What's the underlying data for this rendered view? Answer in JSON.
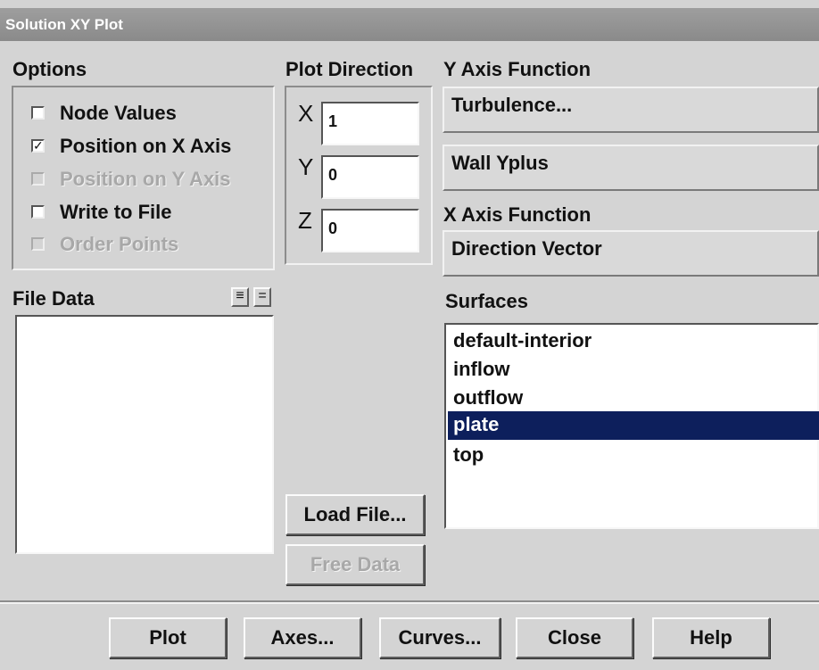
{
  "window": {
    "title": "Solution XY Plot"
  },
  "options": {
    "heading": "Options",
    "items": [
      {
        "label": "Node Values",
        "checked": false,
        "enabled": true
      },
      {
        "label": "Position on X Axis",
        "checked": true,
        "enabled": true
      },
      {
        "label": "Position on Y Axis",
        "checked": false,
        "enabled": false
      },
      {
        "label": "Write to File",
        "checked": false,
        "enabled": true
      },
      {
        "label": "Order Points",
        "checked": false,
        "enabled": false
      }
    ]
  },
  "plot_direction": {
    "heading": "Plot Direction",
    "x_label": "X",
    "x_value": "1",
    "y_label": "Y",
    "y_value": "0",
    "z_label": "Z",
    "z_value": "0"
  },
  "y_axis_function": {
    "heading": "Y Axis Function",
    "category": "Turbulence...",
    "quantity": "Wall Yplus"
  },
  "x_axis_function": {
    "heading": "X Axis Function",
    "value": "Direction Vector"
  },
  "file_data": {
    "heading": "File Data",
    "icon_select_all": "≡",
    "icon_deselect_all": "="
  },
  "surfaces": {
    "heading": "Surfaces",
    "items": [
      "default-interior",
      "inflow",
      "outflow",
      "plate",
      "top"
    ],
    "selected": "plate"
  },
  "buttons": {
    "load_file": "Load File...",
    "free_data": "Free Data",
    "plot": "Plot",
    "axes": "Axes...",
    "curves": "Curves...",
    "close": "Close",
    "help": "Help"
  },
  "colors": {
    "selection": "#0d1f5c",
    "title_bar": "#949494",
    "dialog_bg": "#d4d4d4"
  }
}
